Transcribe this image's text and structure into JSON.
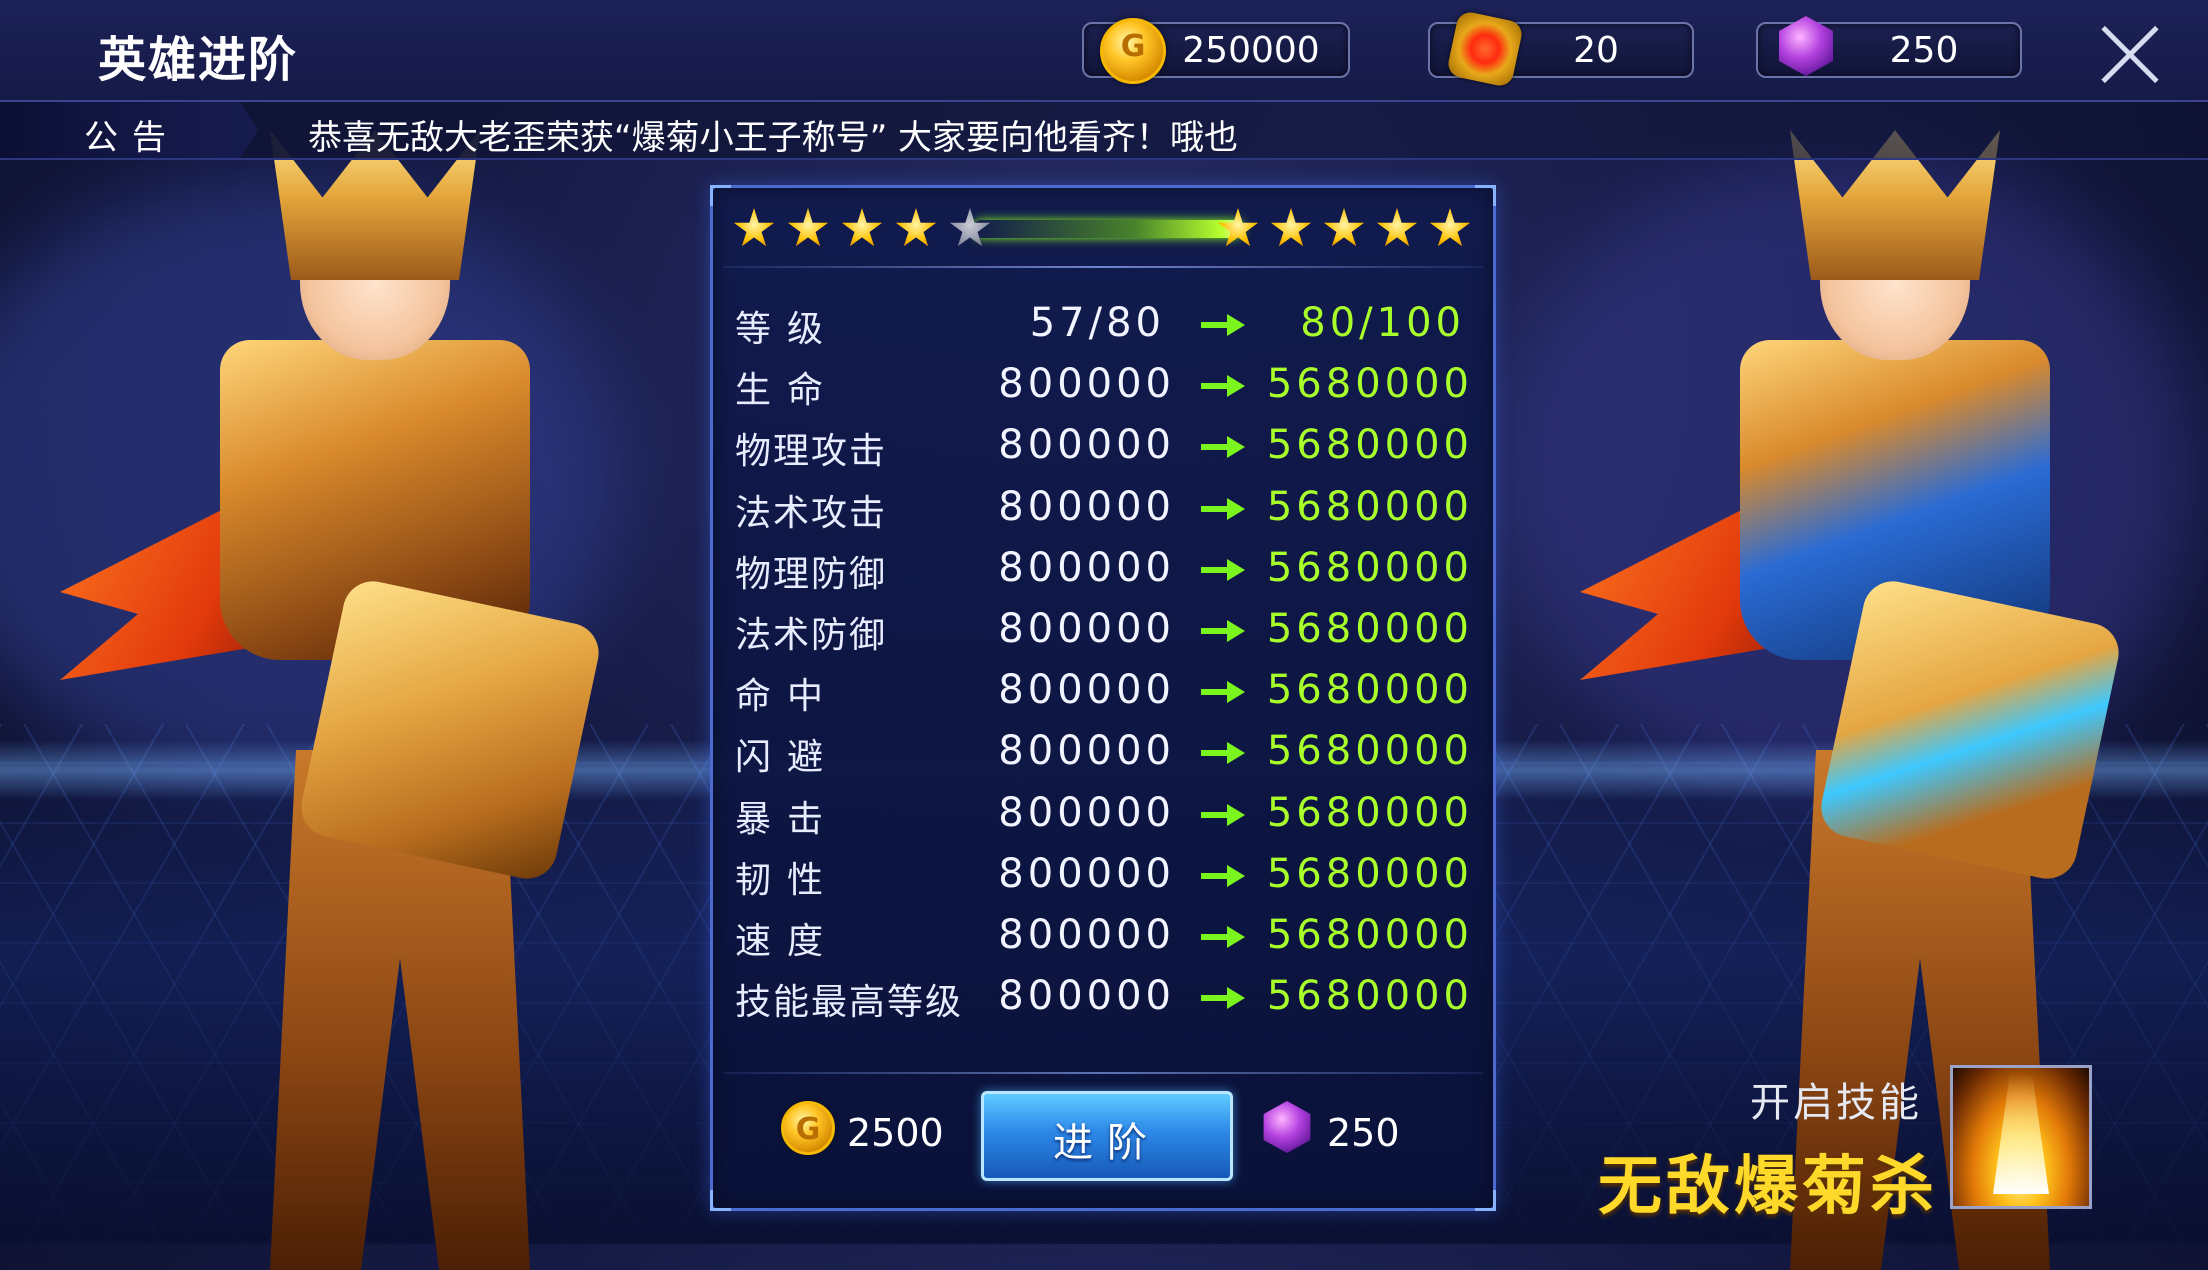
{
  "header": {
    "title": "英雄进阶",
    "gold": "250000",
    "medal": "20",
    "gems": "250"
  },
  "notice": {
    "label": "公告",
    "text": "恭喜无敌大老歪荣获“爆菊小王子称号”  大家要向他看齐！哦也"
  },
  "stars": {
    "current_filled": 4,
    "current_total": 5,
    "next_filled": 5,
    "next_total": 5
  },
  "stats": [
    {
      "label": "等级",
      "current": "57/80",
      "next": "80/100"
    },
    {
      "label": "生命",
      "current": "800000",
      "next": "5680000"
    },
    {
      "label": "物理攻击",
      "current": "800000",
      "next": "5680000"
    },
    {
      "label": "法术攻击",
      "current": "800000",
      "next": "5680000"
    },
    {
      "label": "物理防御",
      "current": "800000",
      "next": "5680000"
    },
    {
      "label": "法术防御",
      "current": "800000",
      "next": "5680000"
    },
    {
      "label": "命中",
      "current": "800000",
      "next": "5680000"
    },
    {
      "label": "闪避",
      "current": "800000",
      "next": "5680000"
    },
    {
      "label": "暴击",
      "current": "800000",
      "next": "5680000"
    },
    {
      "label": "韧性",
      "current": "800000",
      "next": "5680000"
    },
    {
      "label": "速度",
      "current": "800000",
      "next": "5680000"
    },
    {
      "label": "技能最高等级",
      "current": "800000",
      "next": "5680000"
    }
  ],
  "cost": {
    "gold": "2500",
    "gems": "250",
    "button_label": "进阶"
  },
  "skill": {
    "caption": "开启技能",
    "name": "无敌爆菊杀"
  },
  "colors": {
    "accent_green": "#a8ff2a",
    "gold_text": "#ffd92a",
    "panel_border": "#4d6ad0",
    "button_blue": "#2d88e8"
  },
  "icons": {
    "gold": "gold-coin-icon",
    "medal": "medal-icon",
    "gem": "purple-gem-icon",
    "close": "close-icon",
    "star": "star-icon",
    "arrow": "arrow-right-icon",
    "skill": "skill-flame-icon"
  }
}
